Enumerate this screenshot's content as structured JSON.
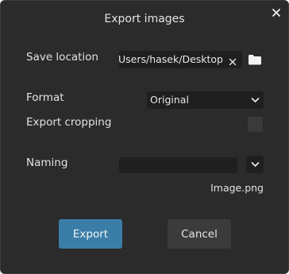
{
  "dialog": {
    "title": "Export images"
  },
  "save_location": {
    "label": "Save location",
    "path": "/Users/hasek/Desktop"
  },
  "format": {
    "label": "Format",
    "selected": "Original"
  },
  "export_cropping": {
    "label": "Export cropping",
    "checked": false
  },
  "naming": {
    "label": "Naming",
    "value": "",
    "preview": "Image.png"
  },
  "buttons": {
    "export_label": "Export",
    "cancel_label": "Cancel"
  },
  "colors": {
    "dialog_background": "#2b2b2b",
    "field_background": "#1f1f1f",
    "accent": "#3a7ea8",
    "secondary_button": "#3b3b3b"
  },
  "icons": {
    "close": "close-icon",
    "clear": "clear-icon",
    "folder": "folder-icon",
    "dropdown": "chevron-down-icon"
  }
}
